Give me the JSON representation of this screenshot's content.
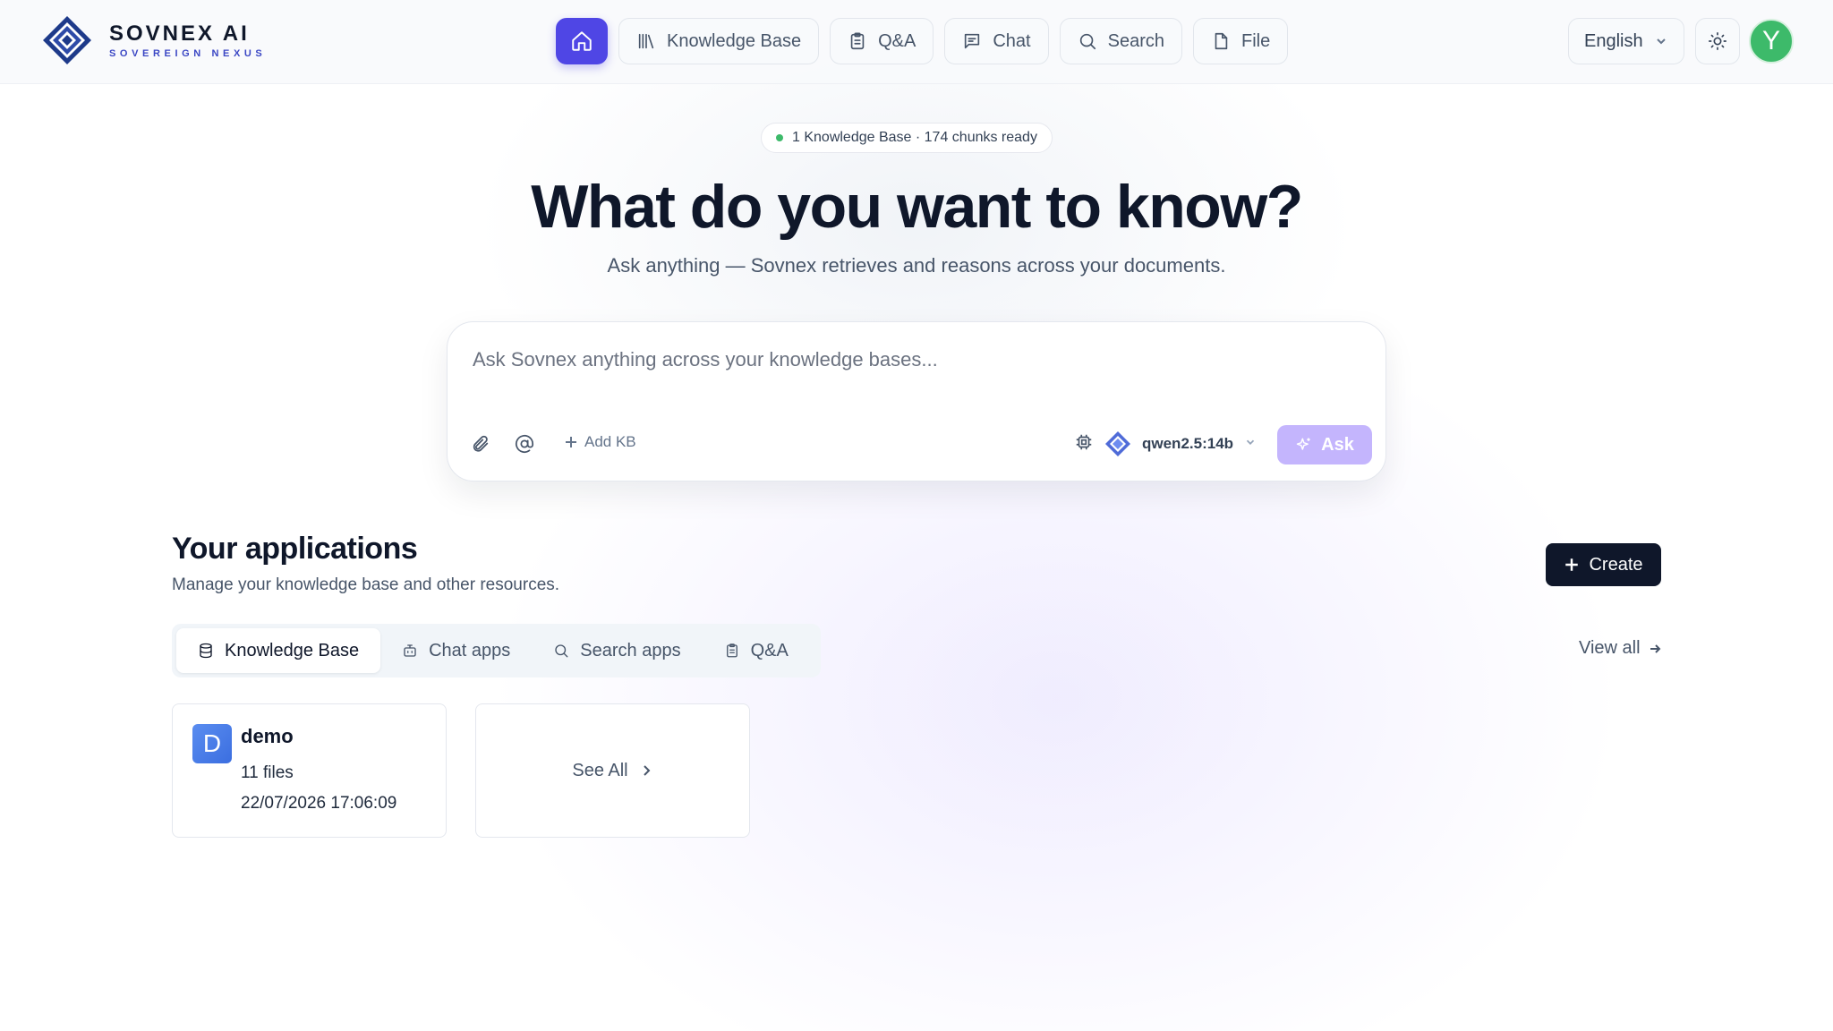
{
  "brand": {
    "name": "SOVNEX AI",
    "tagline": "SOVEREIGN NEXUS"
  },
  "nav": {
    "items": [
      {
        "label": "Knowledge Base",
        "icon": "library-icon"
      },
      {
        "label": "Q&A",
        "icon": "clipboard-icon"
      },
      {
        "label": "Chat",
        "icon": "message-icon"
      },
      {
        "label": "Search",
        "icon": "search-icon"
      },
      {
        "label": "File",
        "icon": "file-icon"
      }
    ],
    "home_icon": "home-icon",
    "active": "home"
  },
  "header": {
    "language": "English",
    "avatar_initial": "Y"
  },
  "hero": {
    "status": "1 Knowledge Base · 174 chunks ready",
    "title": "What do you want to know?",
    "subtitle": "Ask anything — Sovnex retrieves and reasons across your documents."
  },
  "ask": {
    "placeholder": "Ask Sovnex anything across your knowledge bases...",
    "value": "",
    "add_kb_label": "Add KB",
    "model": "qwen2.5:14b",
    "button_label": "Ask"
  },
  "apps": {
    "title": "Your applications",
    "subtitle": "Manage your knowledge base and other resources.",
    "create_label": "Create",
    "view_all_label": "View all",
    "tabs": [
      {
        "label": "Knowledge Base",
        "icon": "database-icon",
        "active": true
      },
      {
        "label": "Chat apps",
        "icon": "bot-icon",
        "active": false
      },
      {
        "label": "Search apps",
        "icon": "search-icon",
        "active": false
      },
      {
        "label": "Q&A",
        "icon": "clipboard-icon",
        "active": false
      }
    ],
    "cards": [
      {
        "initial": "D",
        "name": "demo",
        "files": "11 files",
        "date": "22/07/2026 17:06:09"
      }
    ],
    "see_all_label": "See All"
  },
  "colors": {
    "accent": "#4f46e5",
    "ask_button": "#c4b5fd",
    "status_dot": "#3dba6a",
    "avatar": "#3dba6a",
    "create_button": "#0f172a"
  }
}
